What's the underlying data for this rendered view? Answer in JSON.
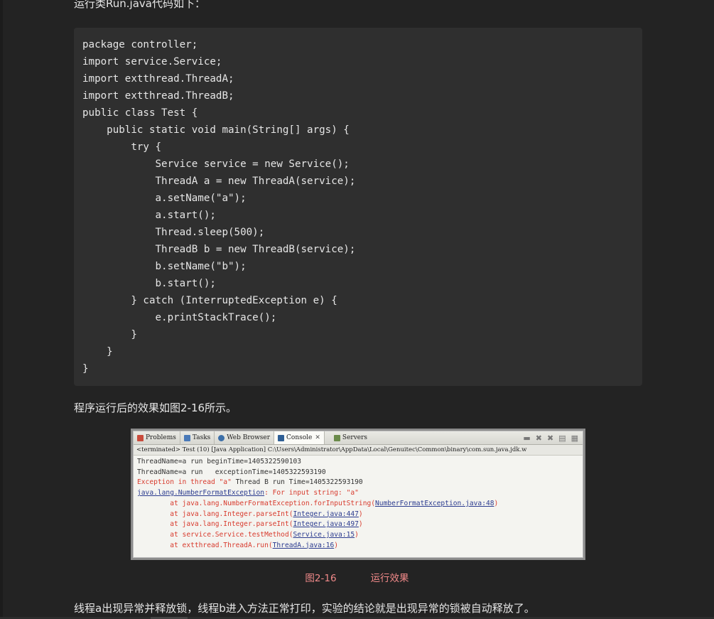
{
  "intro_text": "运行类Run.java代码如下：",
  "code": {
    "lines": [
      "package controller;",
      "import service.Service;",
      "import extthread.ThreadA;",
      "import extthread.ThreadB;",
      "public class Test {",
      "    public static void main(String[] args) {",
      "        try {",
      "            Service service = new Service();",
      "            ThreadA a = new ThreadA(service);",
      "            a.setName(\"a\");",
      "            a.start();",
      "            Thread.sleep(500);",
      "            ThreadB b = new ThreadB(service);",
      "            b.setName(\"b\");",
      "            b.start();",
      "        } catch (InterruptedException e) {",
      "            e.printStackTrace();",
      "        }",
      "    }",
      "}"
    ]
  },
  "para1": "程序运行后的效果如图2-16所示。",
  "figure": {
    "tabs": {
      "problems": "Problems",
      "tasks": "Tasks",
      "web_browser": "Web Browser",
      "console": "Console",
      "servers": "Servers"
    },
    "terminated": "<terminated> Test (10) [Java Application] C:\\Users\\Administrator\\AppData\\Local\\Genuitec\\Common\\binary\\com.sun.java.jdk.w",
    "out1": "ThreadName=a run beginTime=1405322590103",
    "out2": "ThreadName=a run   exceptionTime=1405322593190",
    "err1_a": "Exception in thread \"a\"",
    "err1_b": " Thread B run Time=1405322593190",
    "exc_class": "java.lang.NumberFormatException",
    "exc_msg": ": For input string: \"a\"",
    "at": "        at ",
    "frame1_m": "java.lang.NumberFormatException.forInputString(",
    "frame1_l": "NumberFormatException.java:48",
    "frame2_m": "java.lang.Integer.parseInt(",
    "frame2_l": "Integer.java:447",
    "frame3_m": "java.lang.Integer.parseInt(",
    "frame3_l": "Integer.java:497",
    "frame4_m": "service.Service.testMethod(",
    "frame4_l": "Service.java:15",
    "frame5_m": "extthread.ThreadA.run(",
    "frame5_l": "ThreadA.java:16",
    "close_paren": ")"
  },
  "caption_num": "图2-16",
  "caption_text": "运行效果",
  "para2": "线程a出现异常并释放锁，线程b进入方法正常打印，实验的结论就是出现异常的锁被自动释放了。",
  "colors": {
    "background": "#232323",
    "code_bg": "#2f2f2f",
    "caption": "#f08989",
    "error_red": "#d83b2e",
    "link_blue": "#2b3b8f"
  }
}
